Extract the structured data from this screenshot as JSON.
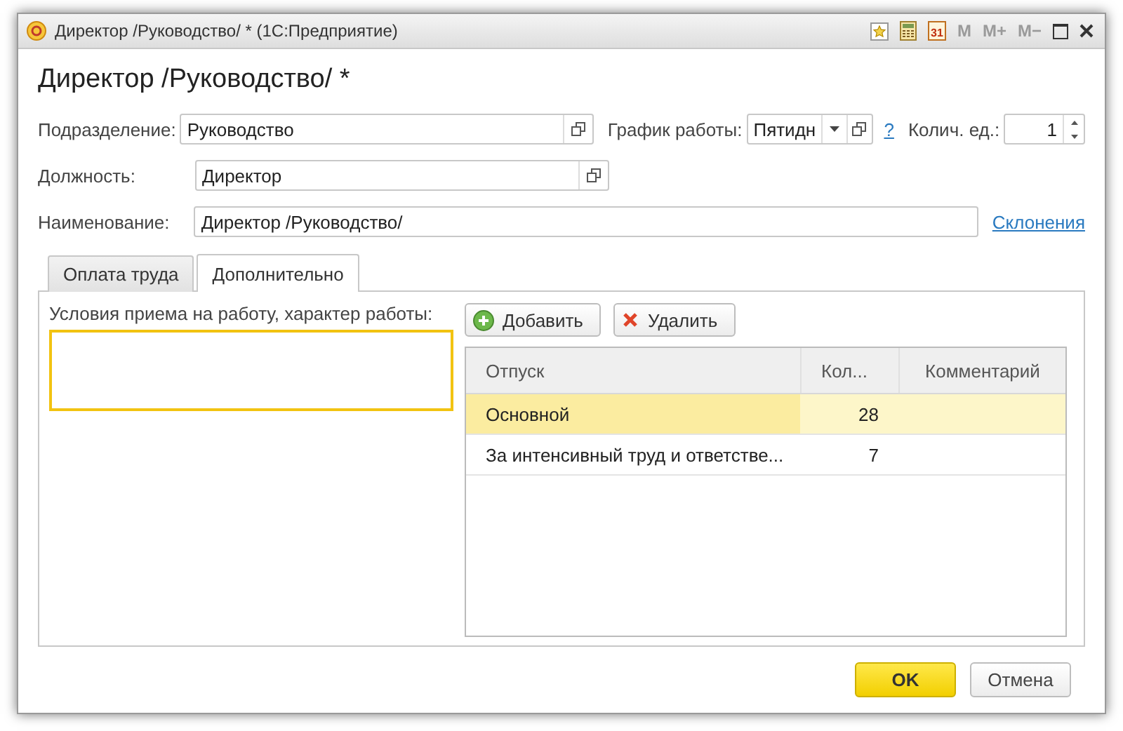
{
  "window": {
    "title": "Директор /Руководство/ * (1С:Предприятие)",
    "calendar_label": "31",
    "memory_buttons": [
      {
        "label": "M",
        "disabled": true
      },
      {
        "label": "M+",
        "disabled": true
      },
      {
        "label": "M−",
        "disabled": true
      }
    ]
  },
  "heading": "Директор /Руководство/ *",
  "fields": {
    "department": {
      "label": "Подразделение:",
      "value": "Руководство"
    },
    "schedule": {
      "label": "График работы:",
      "value": "Пятидн",
      "help": "?"
    },
    "quantity": {
      "label": "Колич. ед.:",
      "value": "1"
    },
    "position": {
      "label": "Должность:",
      "value": "Директор"
    },
    "name": {
      "label": "Наименование:",
      "value": "Директор /Руководство/",
      "link": "Склонения"
    }
  },
  "tabs": [
    {
      "label": "Оплата труда",
      "selected": false
    },
    {
      "label": "Дополнительно",
      "selected": true
    }
  ],
  "conditions": {
    "label": "Условия приема на работу, характер работы:",
    "focused": true
  },
  "toolbar": [
    {
      "kind": "add",
      "label": "Добавить"
    },
    {
      "kind": "delete",
      "label": "Удалить"
    }
  ],
  "table": {
    "columns": [
      "Отпуск",
      "Кол...",
      "Комментарий"
    ],
    "rows": [
      {
        "cells": [
          "Основной",
          "28",
          ""
        ],
        "selected": true
      },
      {
        "cells": [
          "За интенсивный труд и ответстве...",
          "7",
          ""
        ],
        "selected": false
      }
    ]
  },
  "footer": [
    {
      "label": "OK",
      "default": true
    },
    {
      "label": "Отмена",
      "default": false
    }
  ]
}
